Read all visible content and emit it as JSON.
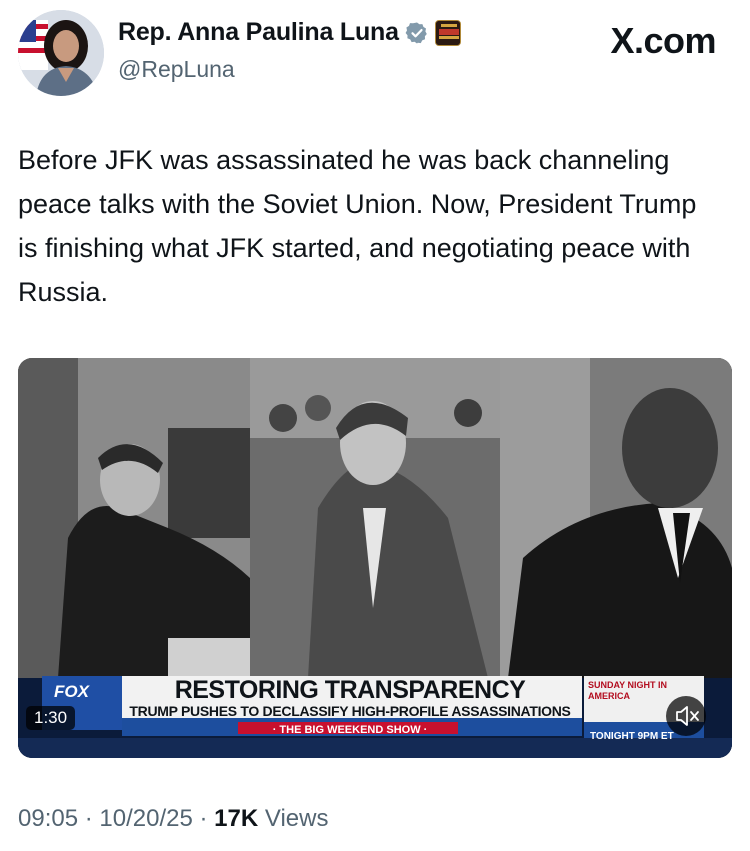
{
  "author": {
    "name": "Rep. Anna Paulina Luna",
    "handle": "@RepLuna",
    "verified_icon": "verified-badge-icon",
    "affiliation_icon": "affiliate-badge-icon",
    "verified_color": "#829aab"
  },
  "brand": {
    "label": "X.com"
  },
  "tweet": {
    "text": "Before JFK was assassinated he was back channeling peace talks with the Soviet Union. Now, President Trump is finishing what JFK started, and negotiating peace with Russia."
  },
  "video": {
    "duration": "1:30",
    "chyron_title": "RESTORING TRANSPARENCY",
    "chyron_subtitle": "TRUMP PUSHES TO DECLASSIFY HIGH-PROFILE ASSASSINATIONS",
    "show_name": "· THE BIG WEEKEND SHOW ·",
    "network": "FOX",
    "promo_top": "SUNDAY NIGHT IN AMERICA",
    "promo_bottom": "TONIGHT 9PM ET",
    "mute_icon": "muted-speaker-icon"
  },
  "meta": {
    "time": "09:05",
    "date": "10/20/25",
    "views_count": "17K",
    "views_label": "Views",
    "separator": "·"
  }
}
